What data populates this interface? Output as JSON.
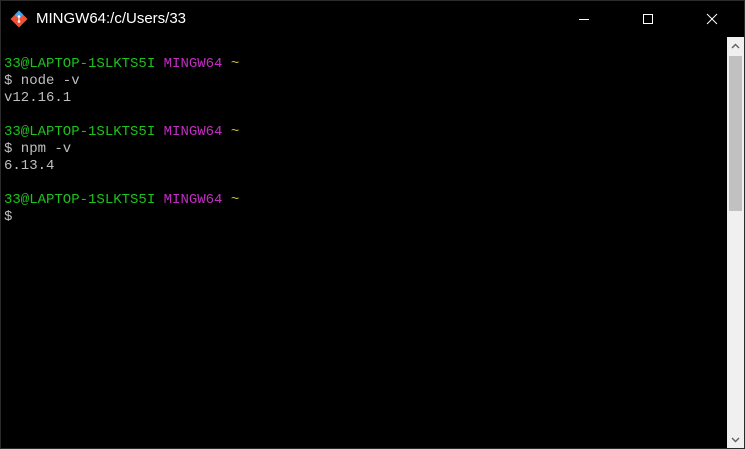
{
  "window": {
    "title": "MINGW64:/c/Users/33"
  },
  "controls": {
    "minimize_icon": "minimize-icon",
    "maximize_icon": "maximize-icon",
    "close_icon": "close-icon"
  },
  "terminal": {
    "blocks": [
      {
        "user_host": "33@LAPTOP-1SLKTS5I",
        "system": "MINGW64",
        "dir": "~",
        "command": "$ node -v",
        "output": "v12.16.1"
      },
      {
        "user_host": "33@LAPTOP-1SLKTS5I",
        "system": "MINGW64",
        "dir": "~",
        "command": "$ npm -v",
        "output": "6.13.4"
      },
      {
        "user_host": "33@LAPTOP-1SLKTS5I",
        "system": "MINGW64",
        "dir": "~",
        "command": "$",
        "output": ""
      }
    ]
  },
  "colors": {
    "background": "#000000",
    "prompt_user": "#1cc31c",
    "prompt_system": "#c12dc1",
    "prompt_dir": "#c1c11c",
    "text": "#bfbfbf"
  }
}
